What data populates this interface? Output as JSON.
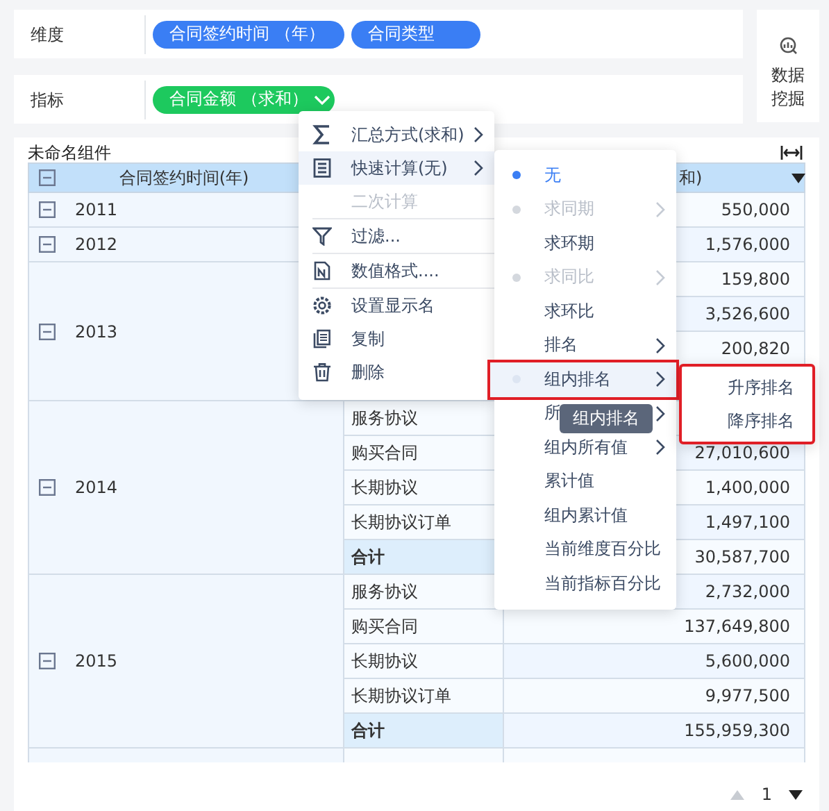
{
  "filters": [
    {
      "label": "维度",
      "kind": "dimension",
      "pills": [
        {
          "text": "合同签约时间 （年）",
          "dropdown": false
        },
        {
          "text": "合同类型",
          "dropdown": false
        }
      ]
    },
    {
      "label": "指标",
      "kind": "measure",
      "pills": [
        {
          "text": "合同金额 （求和）",
          "dropdown": true
        }
      ]
    }
  ],
  "mining_button": {
    "label": "数据挖掘"
  },
  "widget_title": "未命名组件",
  "table": {
    "header": {
      "year": {
        "label": "合同签约时间(年)",
        "expanded": true
      },
      "column_3": {
        "label": "和)"
      }
    },
    "groups": [
      {
        "year": "2011",
        "expanded": true,
        "rows": [
          {
            "value": "550,000"
          }
        ]
      },
      {
        "year": "2012",
        "expanded": true,
        "rows": [
          {
            "value": "1,576,000"
          }
        ]
      },
      {
        "year": "2013",
        "expanded": true,
        "rows": [
          {
            "value": "159,800"
          },
          {
            "value": "3,526,600"
          },
          {
            "value": "200,820"
          },
          {}
        ]
      },
      {
        "year": "2014",
        "expanded": true,
        "rows": [
          {
            "type": "服务协议",
            "total": false
          },
          {
            "type": "购买合同",
            "value": "27,010,600",
            "total": false
          },
          {
            "type": "长期协议",
            "value": "1,400,000",
            "total": false
          },
          {
            "type": "长期协议订单",
            "value": "1,497,100",
            "total": false
          },
          {
            "type": "合计",
            "value": "30,587,700",
            "total": true
          }
        ]
      },
      {
        "year": "2015",
        "expanded": true,
        "rows": [
          {
            "type": "服务协议",
            "value": "2,732,000",
            "total": false
          },
          {
            "type": "购买合同",
            "value": "137,649,800",
            "total": false
          },
          {
            "type": "长期协议",
            "value": "5,600,000",
            "total": false
          },
          {
            "type": "长期协议订单",
            "value": "9,977,500",
            "total": false
          },
          {
            "type": "合计",
            "value": "155,959,300",
            "total": true
          }
        ]
      }
    ]
  },
  "context_menu": {
    "items": [
      {
        "label": "汇总方式(求和)",
        "submenu": true,
        "selected": false,
        "disabled": false,
        "divider_before": false
      },
      {
        "label": "快速计算(无)",
        "submenu": true,
        "selected": true,
        "disabled": false,
        "divider_before": false
      },
      {
        "label": "二次计算",
        "submenu": false,
        "selected": false,
        "disabled": true,
        "divider_before": false
      },
      {
        "label": "过滤...",
        "submenu": false,
        "selected": false,
        "disabled": false,
        "divider_before": true
      },
      {
        "label": "数值格式....",
        "submenu": false,
        "selected": false,
        "disabled": false,
        "divider_before": true
      },
      {
        "label": "设置显示名",
        "submenu": false,
        "selected": false,
        "disabled": false,
        "divider_before": true
      },
      {
        "label": "复制",
        "submenu": false,
        "selected": false,
        "disabled": false,
        "divider_before": false
      },
      {
        "label": "删除",
        "submenu": false,
        "selected": false,
        "disabled": false,
        "divider_before": false
      }
    ]
  },
  "quick_calc_menu": {
    "items": [
      {
        "label": "无",
        "selected": true,
        "disabled": false,
        "highlighted": false,
        "submenu": false,
        "outlined": false
      },
      {
        "label": "求同期",
        "selected": false,
        "disabled": true,
        "highlighted": false,
        "submenu": true,
        "outlined": false
      },
      {
        "label": "求环期",
        "selected": false,
        "disabled": false,
        "highlighted": false,
        "submenu": false,
        "outlined": false
      },
      {
        "label": "求同比",
        "selected": false,
        "disabled": true,
        "highlighted": false,
        "submenu": true,
        "outlined": false
      },
      {
        "label": "求环比",
        "selected": false,
        "disabled": false,
        "highlighted": false,
        "submenu": false,
        "outlined": false
      },
      {
        "label": "排名",
        "selected": false,
        "disabled": false,
        "highlighted": false,
        "submenu": true,
        "outlined": false
      },
      {
        "label": "组内排名",
        "selected": false,
        "disabled": false,
        "highlighted": true,
        "submenu": true,
        "outlined": true
      },
      {
        "label": "所",
        "selected": false,
        "disabled": false,
        "highlighted": false,
        "submenu": true,
        "outlined": false
      },
      {
        "label": "组内所有值",
        "selected": false,
        "disabled": false,
        "highlighted": false,
        "submenu": true,
        "outlined": false
      },
      {
        "label": "累计值",
        "selected": false,
        "disabled": false,
        "highlighted": false,
        "submenu": false,
        "outlined": false
      },
      {
        "label": "组内累计值",
        "selected": false,
        "disabled": false,
        "highlighted": false,
        "submenu": false,
        "outlined": false
      },
      {
        "label": "当前维度百分比",
        "selected": false,
        "disabled": false,
        "highlighted": false,
        "submenu": false,
        "outlined": false
      },
      {
        "label": "当前指标百分比",
        "selected": false,
        "disabled": false,
        "highlighted": false,
        "submenu": false,
        "outlined": false
      }
    ]
  },
  "rank_menu": {
    "outlined": true,
    "items": [
      {
        "label": "升序排名"
      },
      {
        "label": "降序排名"
      }
    ]
  },
  "tooltip": {
    "text": "组内排名"
  },
  "pagination": {
    "page": "1",
    "prev_disabled": true,
    "next_disabled": false
  }
}
